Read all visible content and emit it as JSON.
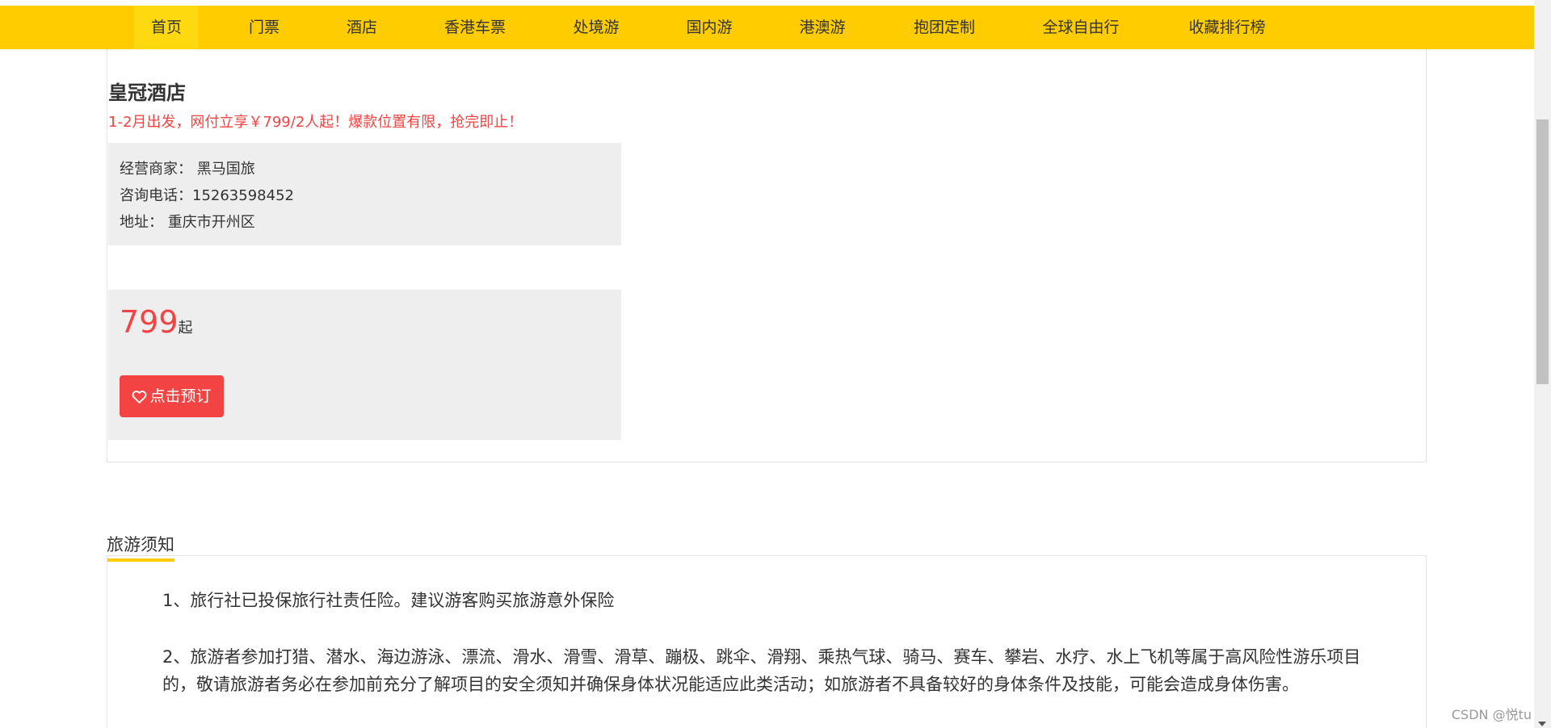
{
  "nav": {
    "items": [
      "首页",
      "门票",
      "酒店",
      "香港车票",
      "处境游",
      "国内游",
      "港澳游",
      "抱团定制",
      "全球自由行",
      "收藏排行榜"
    ],
    "active_index": 0,
    "bg_color": "#ffcc00"
  },
  "hotel": {
    "name": "皇冠酒店",
    "promo": "1-2月出发，网付立享￥799/2人起！爆款位置有限，抢完即止！",
    "merchant_label": "经营商家：",
    "merchant_value": "黑马国旅",
    "phone_label": "咨询电话：",
    "phone_value": "15263598452",
    "address_label": "地址：",
    "address_value": "重庆市开州区",
    "price": "799",
    "price_unit": "起",
    "book_label": "点击预订",
    "accent_color": "#f44343"
  },
  "notice": {
    "title": "旅游须知",
    "paragraphs": [
      "1、旅行社已投保旅行社责任险。建议游客购买旅游意外保险",
      "2、旅游者参加打猎、潜水、海边游泳、漂流、滑水、滑雪、滑草、蹦极、跳伞、滑翔、乘热气球、骑马、赛车、攀岩、水疗、水上飞机等属于高风险性游乐项目的，敬请旅游者务必在参加前充分了解项目的安全须知并确保身体状况能适应此类活动；如旅游者不具备较好的身体条件及技能，可能会造成身体伤害。"
    ]
  },
  "watermark": "CSDN @悦tu"
}
